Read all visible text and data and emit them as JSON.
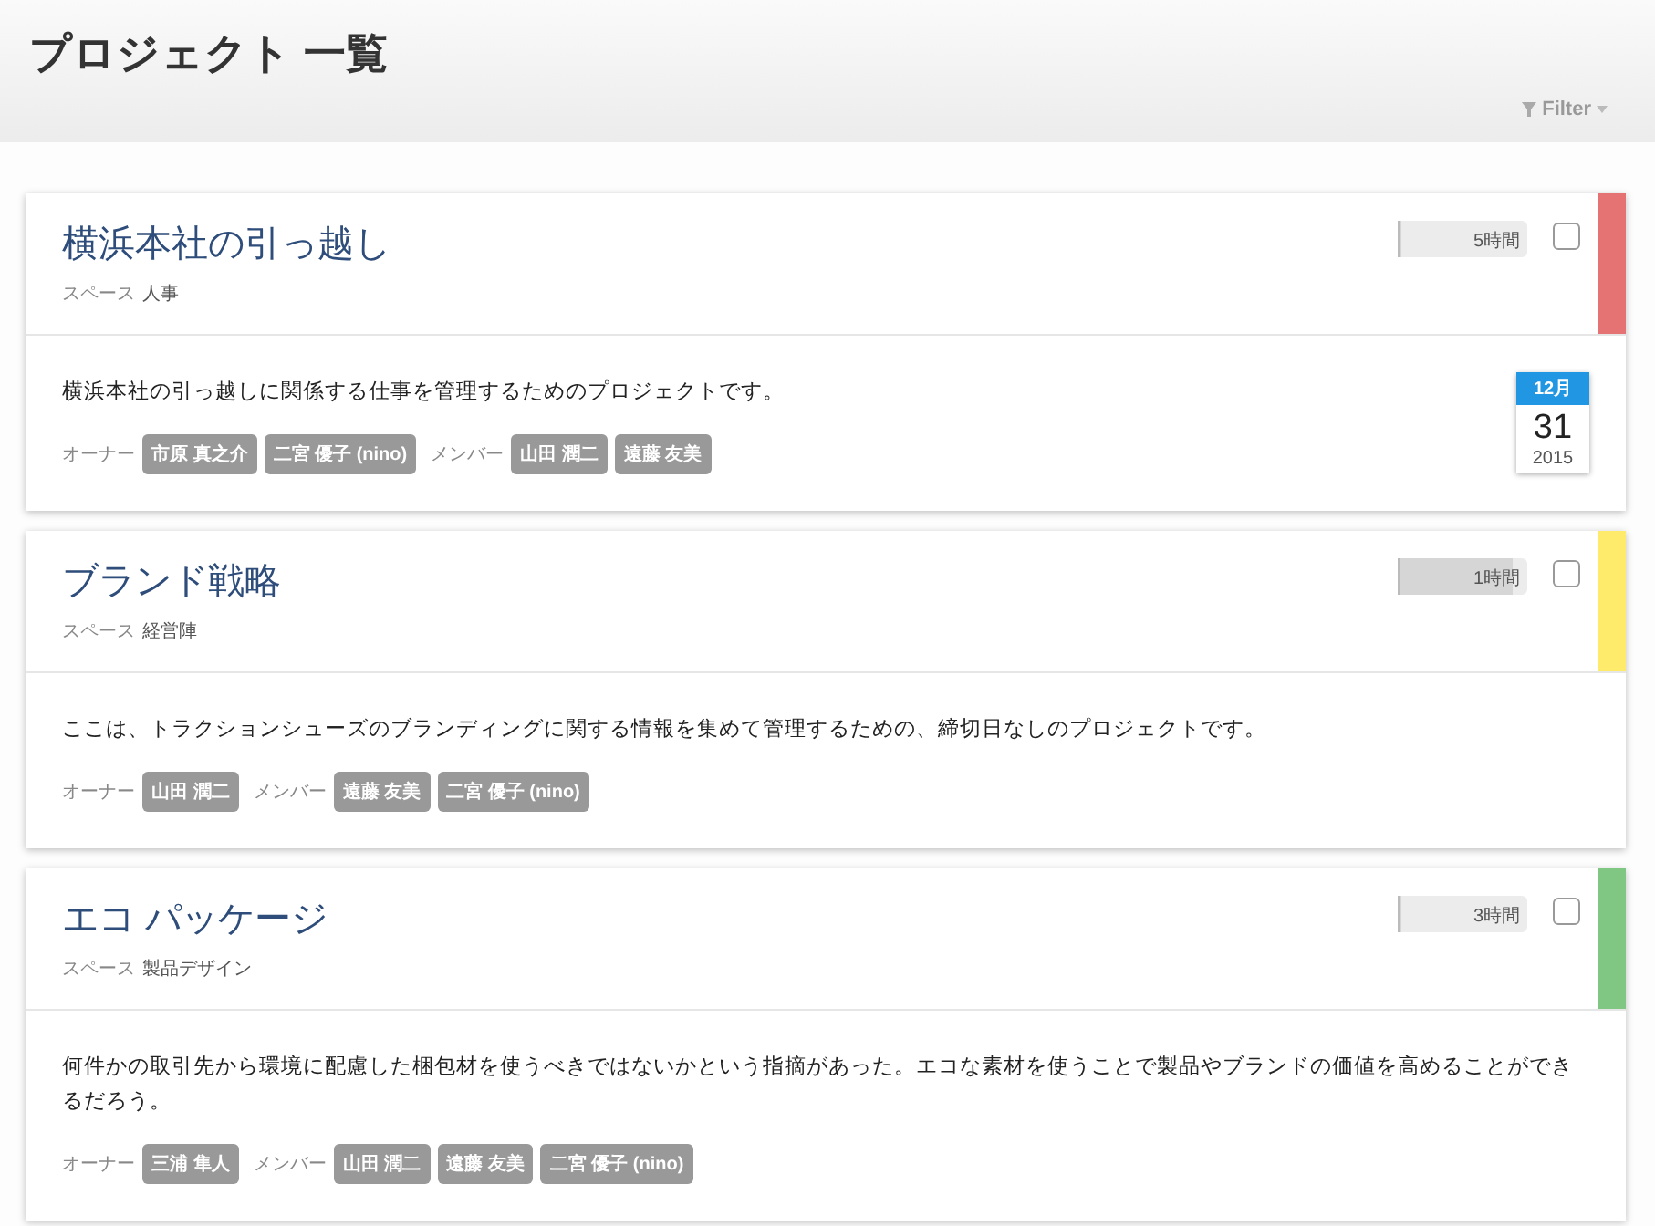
{
  "page": {
    "title": "プロジェクト 一覧",
    "filter": "Filter"
  },
  "projects": [
    {
      "title": "横浜本社の引っ越し",
      "space_label": "スペース",
      "space": "人事",
      "hours": "5時間",
      "level": 0.01,
      "checked": false,
      "color": "#e57373",
      "description": "横浜本社の引っ越しに関係する仕事を管理するためのプロジェクトです。",
      "owner_label": "オーナー",
      "owners": [
        "市原 真之介",
        "二宮 優子 (nino)"
      ],
      "member_label": "メンバー",
      "members": [
        "山田 潤二",
        "遠藤 友美"
      ],
      "due": {
        "month": "12月",
        "day": "31",
        "year": "2015"
      }
    },
    {
      "title": "ブランド戦略",
      "space_label": "スペース",
      "space": "経営陣",
      "hours": "1時間",
      "level": 0.88,
      "checked": false,
      "color": "#ffeb6b",
      "description": "ここは、トラクションシューズのブランディングに関する情報を集めて管理するための、締切日なしのプロジェクトです。",
      "owner_label": "オーナー",
      "owners": [
        "山田 潤二"
      ],
      "member_label": "メンバー",
      "members": [
        "遠藤 友美",
        "二宮 優子 (nino)"
      ]
    },
    {
      "title": "エコ パッケージ",
      "space_label": "スペース",
      "space": "製品デザイン",
      "hours": "3時間",
      "level": 0.01,
      "checked": false,
      "color": "#81c784",
      "description": "何件かの取引先から環境に配慮した梱包材を使うべきではないかという指摘があった。エコな素材を使うことで製品やブランドの価値を高めることができるだろう。",
      "owner_label": "オーナー",
      "owners": [
        "三浦 隼人"
      ],
      "member_label": "メンバー",
      "members": [
        "山田 潤二",
        "遠藤 友美",
        "二宮 優子 (nino)"
      ]
    }
  ]
}
